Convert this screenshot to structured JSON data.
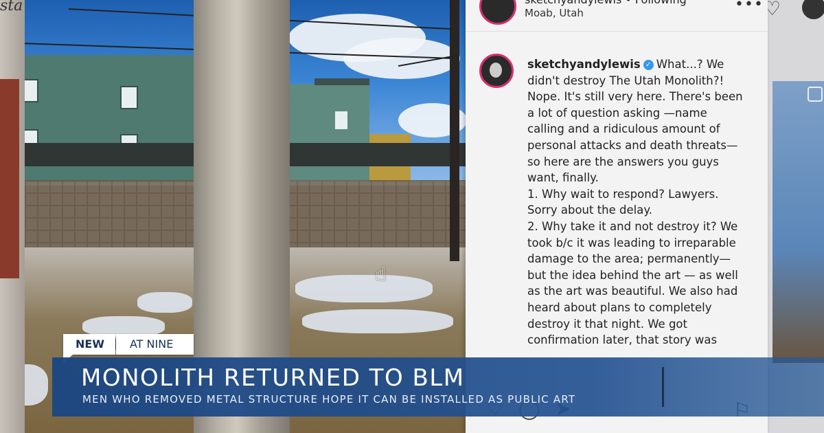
{
  "background": {
    "left_logo_text": "sta"
  },
  "instagram": {
    "header_user": "sketchyandylewis • Following",
    "location": "Moab, Utah",
    "more_icon": "more-dots-icon",
    "caption_user": "sketchyandylewis",
    "verified_icon": "verified-badge-icon",
    "caption_lines": [
      "What...? We",
      "didn't destroy The Utah Monolith?!",
      "Nope. It's still very here. There's been",
      "a lot of question asking —name",
      "calling and a ridiculous amount of",
      "personal attacks and death threats—",
      "so here are the answers you guys",
      "want, finally.",
      "1. Why wait to respond? Lawyers.",
      "Sorry about the delay.",
      "2. Why take it and not destroy it? We",
      "took b/c it was leading to irreparable",
      "damage to the area; permanently—",
      "but the idea behind the art — as well",
      "as the art was beautiful. We also had",
      "heard about plans to completely",
      "destroy it that night. We got",
      "confirmation later, that story was"
    ]
  },
  "lower_third": {
    "tag_new": "NEW",
    "tag_show": "AT NINE",
    "headline": "MONOLITH RETURNED TO BLM",
    "subheadline": "MEN WHO REMOVED METAL STRUCTURE HOPE IT CAN BE INSTALLED AS PUBLIC ART",
    "colors": {
      "banner": "#1c4682",
      "tag_text": "#1a2f5a"
    }
  }
}
